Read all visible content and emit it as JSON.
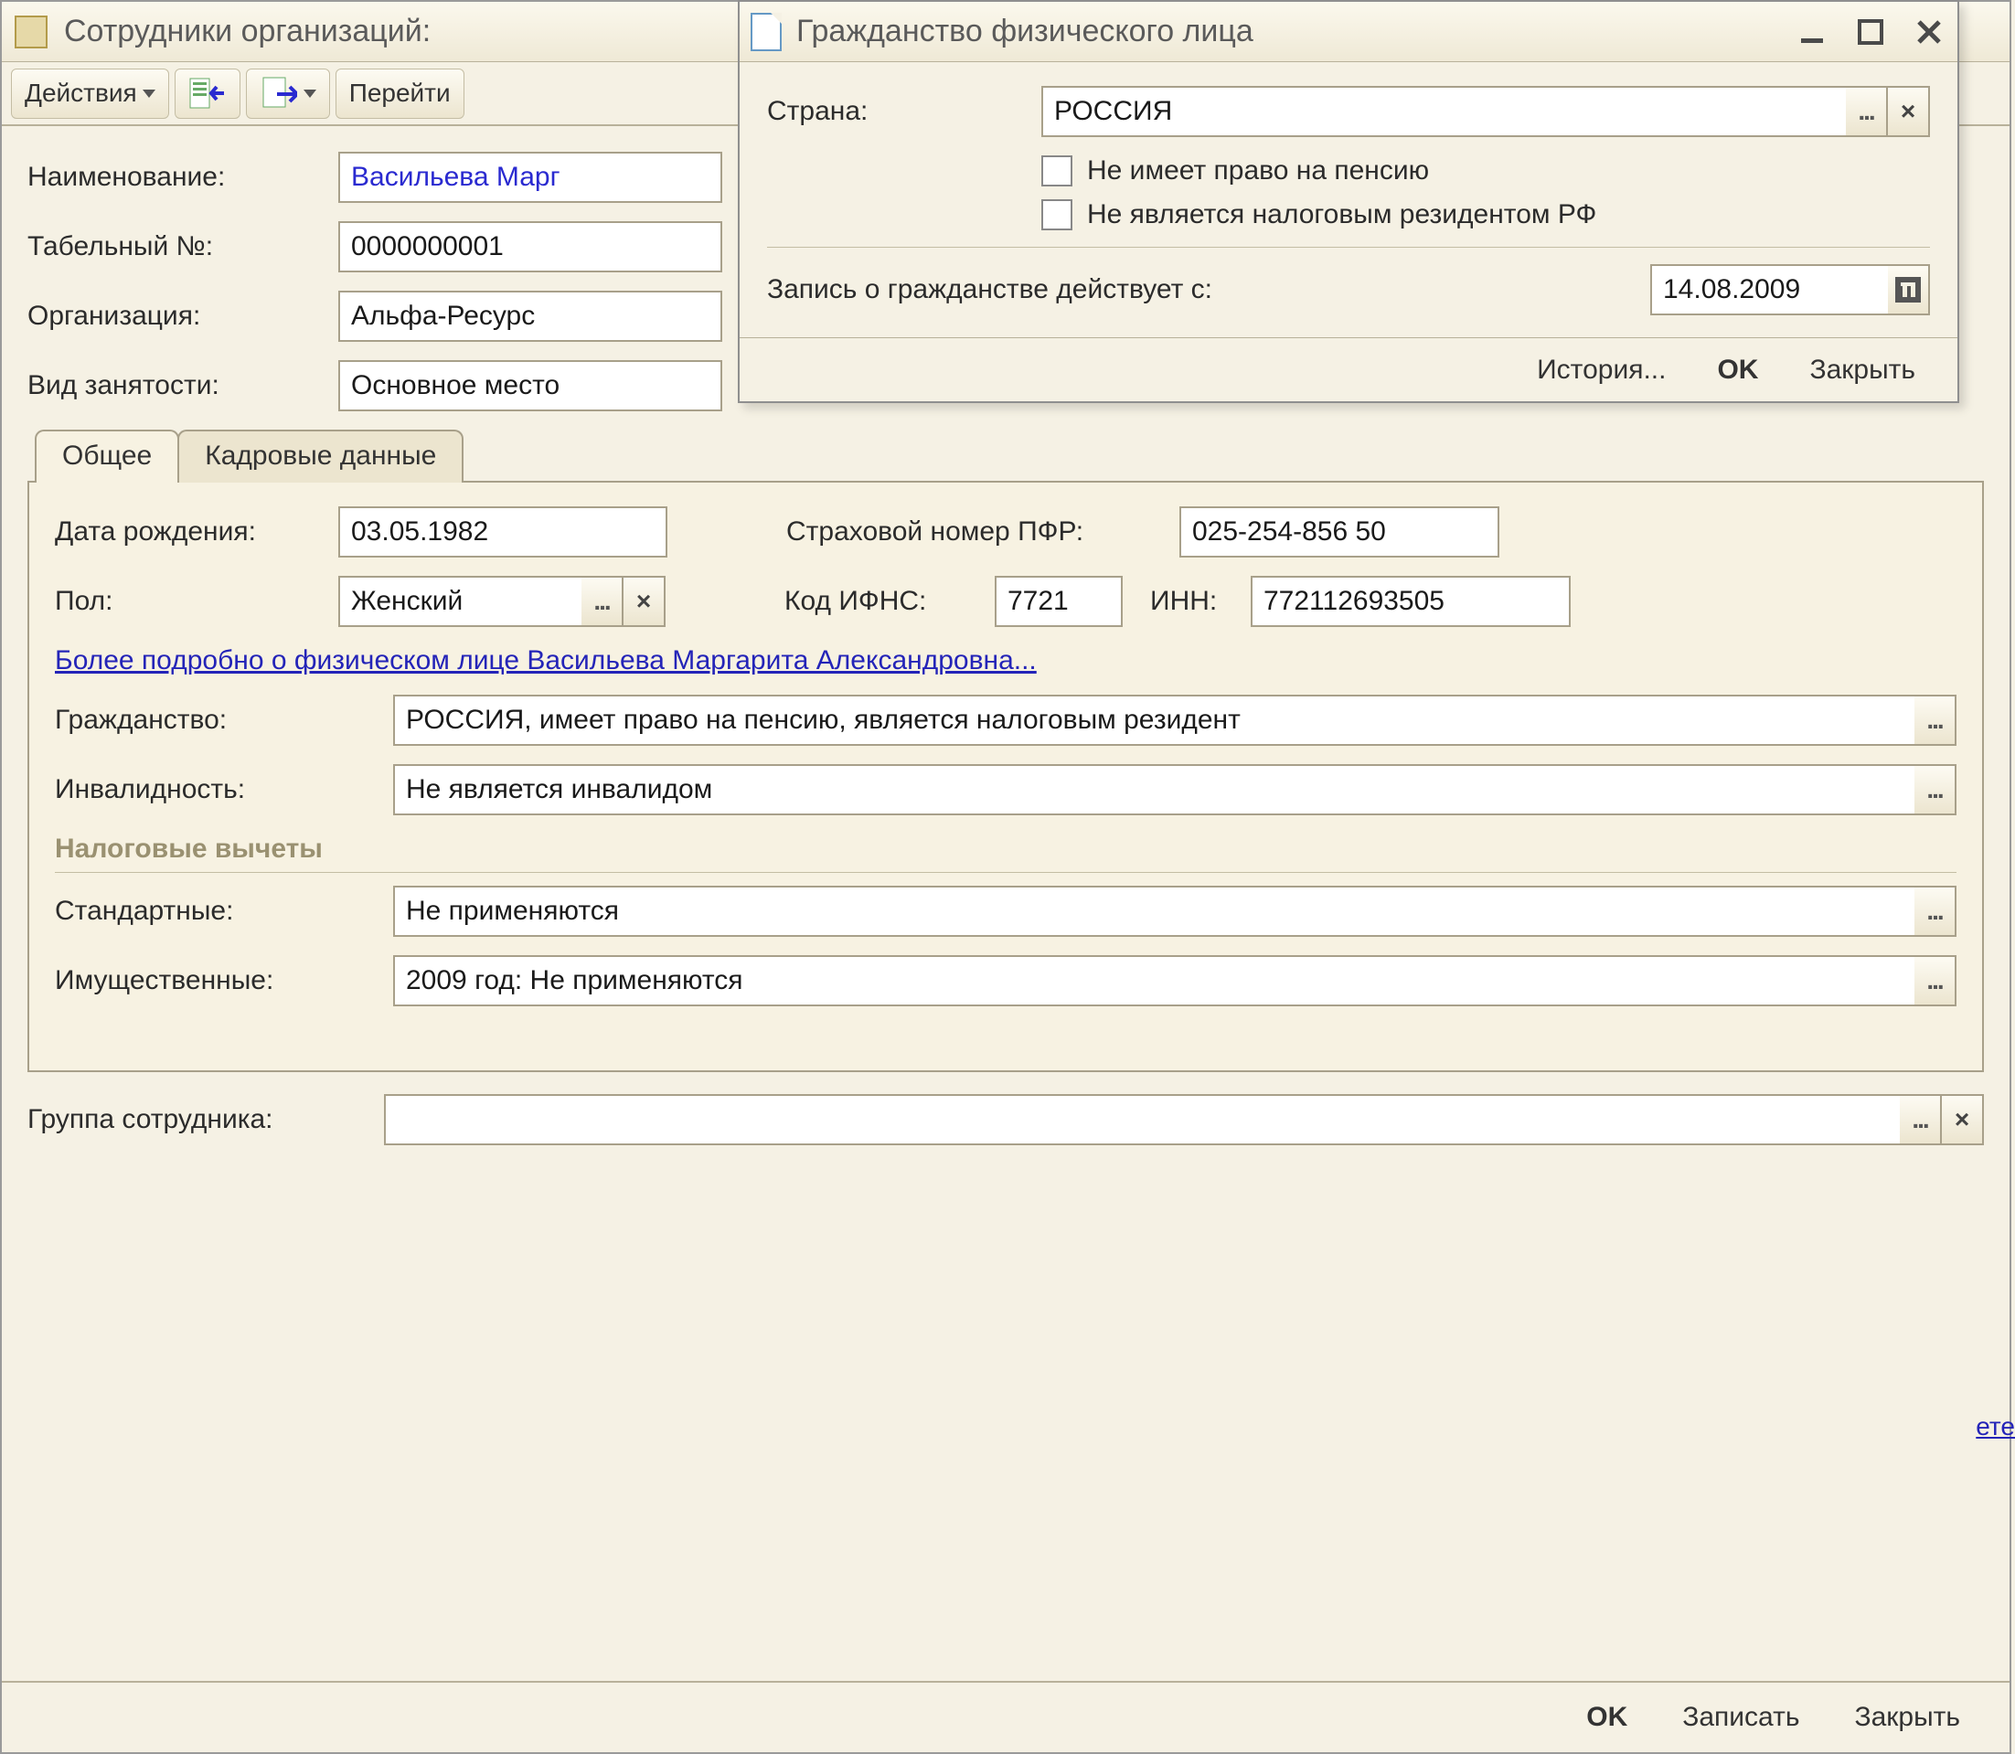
{
  "main": {
    "title": "Сотрудники организаций:",
    "toolbar": {
      "actions": "Действия",
      "goto": "Перейти"
    },
    "labels": {
      "name": "Наименование:",
      "tab_no": "Табельный №:",
      "org": "Организация:",
      "employment": "Вид занятости:"
    },
    "values": {
      "name": "Васильева Марг",
      "tab_no": "0000000001",
      "org": "Альфа-Ресурс",
      "employment": "Основное место"
    },
    "tabs": {
      "general": "Общее",
      "hr": "Кадровые данные"
    },
    "general": {
      "dob_label": "Дата рождения:",
      "dob": "03.05.1982",
      "pfr_label": "Страховой номер ПФР:",
      "pfr": "025-254-856 50",
      "gender_label": "Пол:",
      "gender": "Женский",
      "ifns_label": "Код ИФНС:",
      "ifns": "7721",
      "inn_label": "ИНН:",
      "inn": "772112693505",
      "details_link": "Более подробно о физическом лице Васильева Маргарита Александровна...",
      "citizenship_label": "Гражданство:",
      "citizenship": "РОССИЯ, имеет право на пенсию, является налоговым резидент",
      "disability_label": "Инвалидность:",
      "disability": "Не является инвалидом",
      "deductions_header": "Налоговые вычеты",
      "std_label": "Стандартные:",
      "std": "Не применяются",
      "prop_label": "Имущественные:",
      "prop": "2009 год: Не применяются"
    },
    "group_label": "Группа сотрудника:",
    "group_value": "",
    "footer": {
      "ok": "OK",
      "save": "Записать",
      "close": "Закрыть"
    }
  },
  "modal": {
    "title": "Гражданство физического лица",
    "country_label": "Страна:",
    "country": "РОССИЯ",
    "no_pension_label": "Не имеет право на пенсию",
    "not_resident_label": "Не является налоговым резидентом РФ",
    "effective_label": "Запись о гражданстве действует с:",
    "effective_date": "14.08.2009",
    "footer": {
      "history": "История...",
      "ok": "OK",
      "close": "Закрыть"
    }
  },
  "bg_fragment": "ете"
}
